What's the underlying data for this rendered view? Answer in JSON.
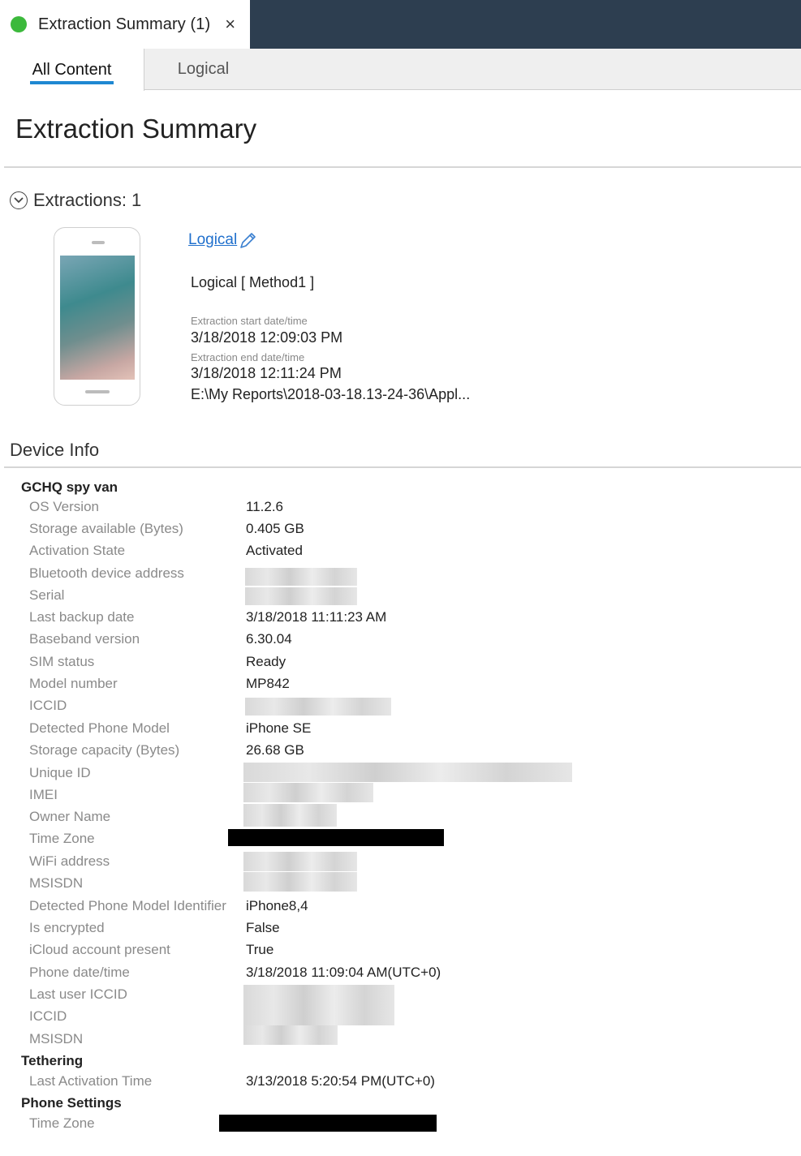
{
  "window": {
    "tab_title": "Extraction Summary (1)",
    "close_glyph": "×",
    "status_color": "#3cb93c"
  },
  "subtabs": [
    {
      "label": "All Content",
      "active": true
    },
    {
      "label": "Logical",
      "active": false
    }
  ],
  "page": {
    "title": "Extraction Summary",
    "extractions_label": "Extractions: 1"
  },
  "extraction": {
    "link": "Logical",
    "method": "Logical [ Method1 ]",
    "start_label": "Extraction start date/time",
    "start_value": "3/18/2018 12:09:03 PM",
    "end_label": "Extraction end date/time",
    "end_value": "3/18/2018 12:11:24 PM",
    "path": "E:\\My Reports\\2018-03-18.13-24-36\\Appl..."
  },
  "device_info": {
    "heading": "Device Info",
    "groups": [
      {
        "name": "GCHQ spy van",
        "rows": [
          {
            "label": "OS Version",
            "value": "11.2.6"
          },
          {
            "label": "Storage available (Bytes)",
            "value": "0.405 GB"
          },
          {
            "label": "Activation State",
            "value": "Activated"
          },
          {
            "label": "Bluetooth device address",
            "value": ""
          },
          {
            "label": "Serial",
            "value": ""
          },
          {
            "label": "Last backup date",
            "value": "3/18/2018 11:11:23 AM"
          },
          {
            "label": "Baseband version",
            "value": "6.30.04"
          },
          {
            "label": "SIM status",
            "value": "Ready"
          },
          {
            "label": "Model number",
            "value": "MP842"
          },
          {
            "label": "ICCID",
            "value": ""
          },
          {
            "label": "Detected Phone Model",
            "value": "iPhone SE"
          },
          {
            "label": "Storage capacity (Bytes)",
            "value": "26.68 GB"
          },
          {
            "label": "Unique ID",
            "value": ""
          },
          {
            "label": "IMEI",
            "value": ""
          },
          {
            "label": "Owner Name",
            "value": ""
          },
          {
            "label": "Time Zone",
            "value": ""
          },
          {
            "label": "WiFi address",
            "value": ""
          },
          {
            "label": "MSISDN",
            "value": ""
          },
          {
            "label": "Detected Phone Model Identifier",
            "value": "iPhone8,4"
          },
          {
            "label": "Is encrypted",
            "value": "False"
          },
          {
            "label": "iCloud account present",
            "value": "True"
          },
          {
            "label": "Phone date/time",
            "value": "3/18/2018 11:09:04 AM(UTC+0)"
          },
          {
            "label": "Last user ICCID",
            "value": ""
          },
          {
            "label": "ICCID",
            "value": ""
          },
          {
            "label": "MSISDN",
            "value": ""
          }
        ]
      },
      {
        "name": "Tethering",
        "rows": [
          {
            "label": "Last Activation Time",
            "value": "3/13/2018 5:20:54 PM(UTC+0)"
          }
        ]
      },
      {
        "name": "Phone Settings",
        "rows": [
          {
            "label": "Time Zone",
            "value": ""
          }
        ]
      }
    ]
  }
}
